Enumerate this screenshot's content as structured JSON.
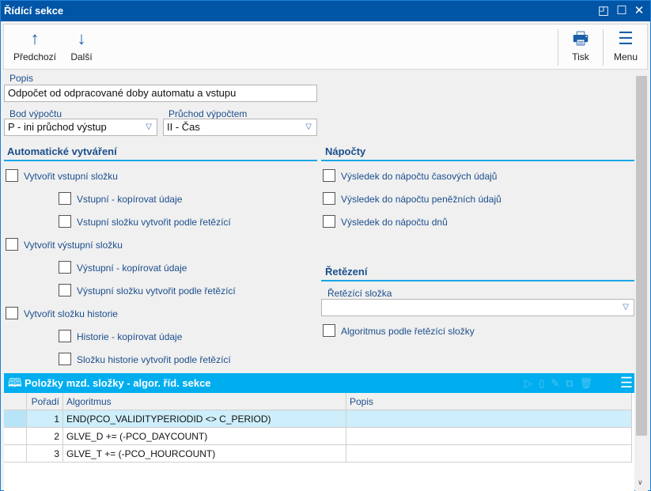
{
  "window": {
    "title": "Řídící sekce"
  },
  "toolbar": {
    "prev": "Předchozí",
    "next": "Další",
    "print": "Tisk",
    "menu": "Menu"
  },
  "form": {
    "popis_label": "Popis",
    "popis_value": "Odpočet od odpracované doby automatu a vstupu",
    "bod_label": "Bod výpočtu",
    "bod_value": "P - ini průchod výstup",
    "pruchod_label": "Průchod výpočtem",
    "pruchod_value": "II - Čas"
  },
  "auto": {
    "title": "Automatické vytváření",
    "items": [
      "Vytvořit vstupní složku",
      "Vstupní - kopírovat údaje",
      "Vstupní složku vytvořit podle řetězící",
      "Vytvořit výstupní složku",
      "Výstupní - kopírovat údaje",
      "Výstupní složku vytvořit podle řetězící",
      "Vytvořit složku historie",
      "Historie - kopírovat údaje",
      "Složku historie vytvořit podle řetězící"
    ]
  },
  "napocty": {
    "title": "Nápočty",
    "items": [
      "Výsledek do nápočtu časových údajů",
      "Výsledek do nápočtu peněžních údajů",
      "Výsledek do nápočtu dnů"
    ]
  },
  "retezeni": {
    "title": "Řetězení",
    "slozka_label": "Řetězící složka",
    "slozka_value": "",
    "alg_label": "Algoritmus podle řetězící složky"
  },
  "grid": {
    "title": "Položky mzd. složky - algor. říd. sekce",
    "columns": [
      "Pořadí",
      "Algoritmus",
      "Popis"
    ],
    "rows": [
      {
        "poradi": "1",
        "algoritmus": "END(PCO_VALIDITYPERIODID <> C_PERIOD)",
        "popis": ""
      },
      {
        "poradi": "2",
        "algoritmus": "GLVE_D += (-PCO_DAYCOUNT)",
        "popis": ""
      },
      {
        "poradi": "3",
        "algoritmus": "GLVE_T += (-PCO_HOURCOUNT)",
        "popis": ""
      }
    ]
  }
}
